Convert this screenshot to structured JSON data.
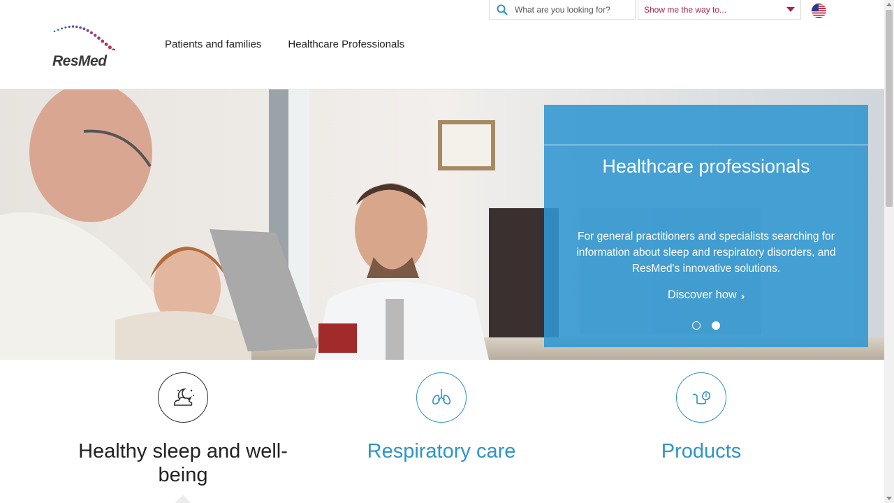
{
  "brand": {
    "name": "ResMed"
  },
  "nav": {
    "items": [
      {
        "label": "Patients and families"
      },
      {
        "label": "Healthcare Professionals"
      }
    ]
  },
  "search": {
    "placeholder": "What are you looking for?"
  },
  "wayfinder": {
    "label": "Show me the way to..."
  },
  "language": {
    "icon": "us-flag-icon"
  },
  "hero": {
    "title": "Healthcare professionals",
    "description": "For general practitioners and specialists searching for information about sleep and respiratory disorders, and ResMed's innovative solutions.",
    "cta": "Discover how",
    "slides": 2,
    "active_slide": 2
  },
  "categories": [
    {
      "label": "Healthy sleep and well-being",
      "icon": "moon-cloud-icon"
    },
    {
      "label": "Respiratory care",
      "icon": "lungs-icon"
    },
    {
      "label": "Products",
      "icon": "mask-icon"
    }
  ],
  "colors": {
    "accent_blue": "#2f93c9",
    "panel_blue": "#3096d0",
    "wayfinder_red": "#a8224b",
    "text_dark": "#222222"
  }
}
